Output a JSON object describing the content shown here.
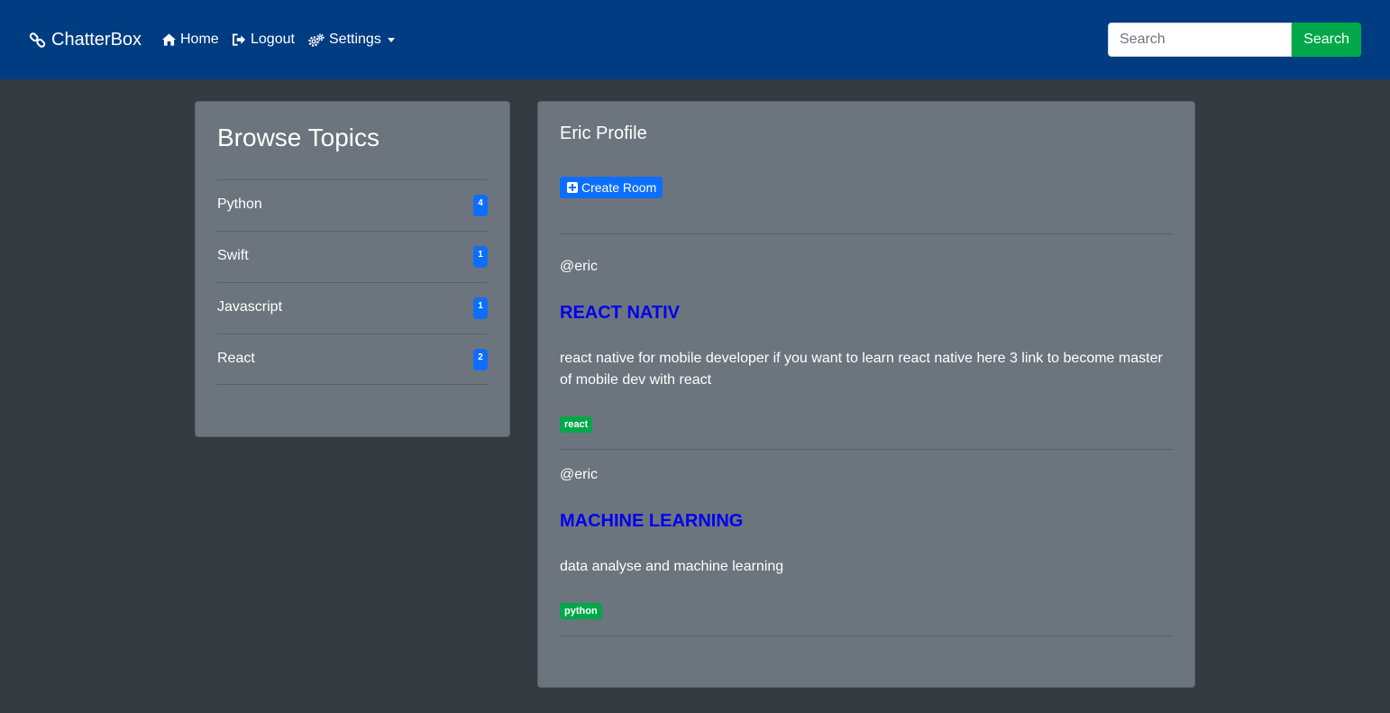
{
  "navbar": {
    "brand": "ChatterBox",
    "brand_icon": "link-icon",
    "links": [
      {
        "label": "Home",
        "icon": "home-icon"
      },
      {
        "label": "Logout",
        "icon": "logout-icon"
      },
      {
        "label": "Settings",
        "icon": "gears-icon"
      }
    ],
    "search": {
      "placeholder": "Search",
      "value": "",
      "button_label": "Search"
    }
  },
  "sidebar": {
    "title": "Browse Topics",
    "topics": [
      {
        "label": "Python",
        "count": "4"
      },
      {
        "label": "Swift",
        "count": "1"
      },
      {
        "label": "Javascript",
        "count": "1"
      },
      {
        "label": "React",
        "count": "2"
      }
    ]
  },
  "profile": {
    "title": "Eric Profile",
    "create_room_label": "Create Room",
    "rooms": [
      {
        "user": "@eric",
        "title": "REACT NATIV",
        "description": "react native for mobile developer if you want to learn react native here 3 link to become master of mobile dev with react",
        "tag": "react"
      },
      {
        "user": "@eric",
        "title": "MACHINE LEARNING",
        "description": "data analyse and machine learning",
        "tag": "python"
      }
    ]
  },
  "colors": {
    "navbar": "#003c82",
    "background": "#343a40",
    "card": "#6c757d",
    "primary": "#0d6efd",
    "success": "#00a84a",
    "room_link": "#0000ee"
  }
}
